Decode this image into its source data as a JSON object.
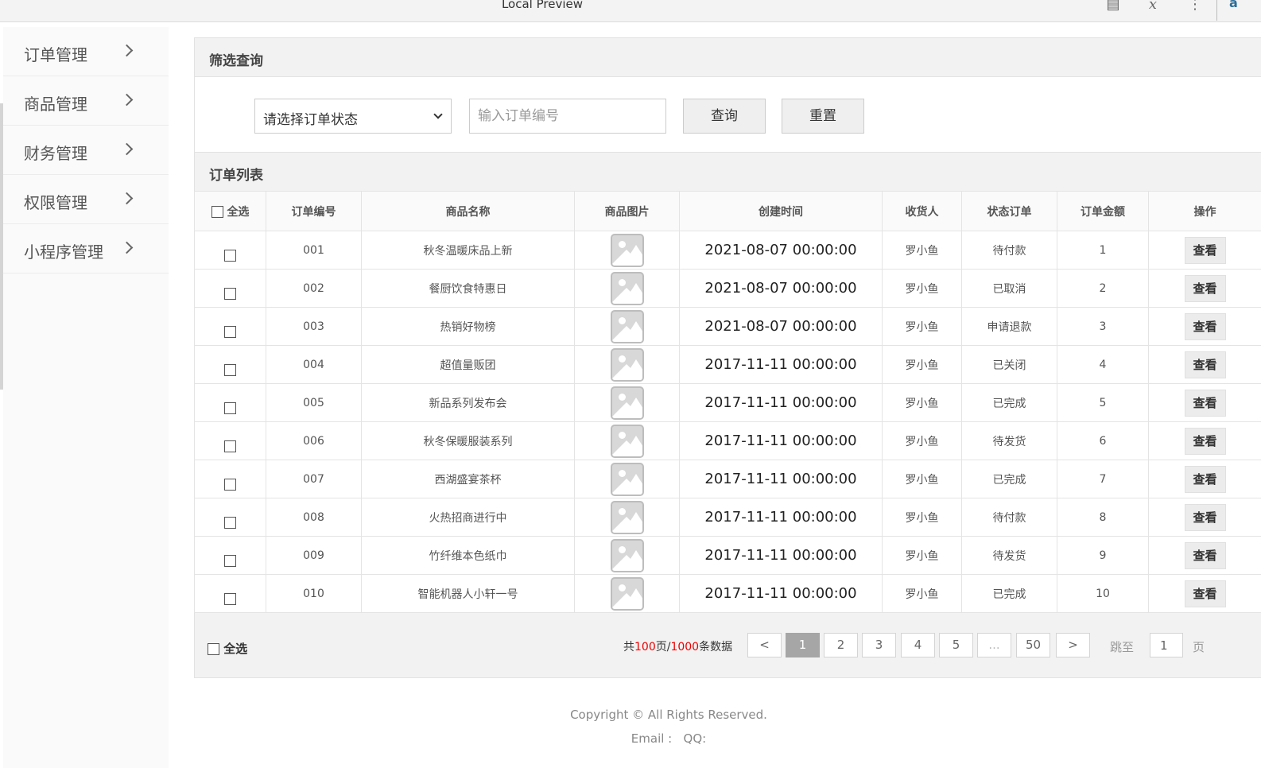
{
  "window": {
    "title": "Local Preview",
    "icons": [
      "document-icon",
      "formula-icon",
      "more-vertical-icon"
    ],
    "corner_text": "a"
  },
  "sidebar": {
    "items": [
      {
        "label": "订单管理"
      },
      {
        "label": "商品管理"
      },
      {
        "label": "财务管理"
      },
      {
        "label": "权限管理"
      },
      {
        "label": "小程序管理"
      }
    ]
  },
  "filter": {
    "title": "筛选查询",
    "status_select_value": "请选择订单状态",
    "order_no_placeholder": "输入订单编号",
    "query_label": "查询",
    "reset_label": "重置"
  },
  "order_list": {
    "title": "订单列表",
    "select_all_label": "全选",
    "columns": [
      "订单编号",
      "商品名称",
      "商品图片",
      "创建时间",
      "收货人",
      "状态订单",
      "订单金额",
      "操作"
    ],
    "view_label": "查看",
    "rows": [
      {
        "id": "001",
        "name": "秋冬温暖床品上新",
        "time": "2021-08-07 00:00:00",
        "receiver": "罗小鱼",
        "status": "待付款",
        "amount": "1"
      },
      {
        "id": "002",
        "name": "餐厨饮食特惠日",
        "time": "2021-08-07 00:00:00",
        "receiver": "罗小鱼",
        "status": "已取消",
        "amount": "2"
      },
      {
        "id": "003",
        "name": "热销好物榜",
        "time": "2021-08-07 00:00:00",
        "receiver": "罗小鱼",
        "status": "申请退款",
        "amount": "3"
      },
      {
        "id": "004",
        "name": "超值量贩团",
        "time": "2017-11-11 00:00:00",
        "receiver": "罗小鱼",
        "status": "已关闭",
        "amount": "4"
      },
      {
        "id": "005",
        "name": "新品系列发布会",
        "time": "2017-11-11 00:00:00",
        "receiver": "罗小鱼",
        "status": "已完成",
        "amount": "5"
      },
      {
        "id": "006",
        "name": "秋冬保暖服装系列",
        "time": "2017-11-11 00:00:00",
        "receiver": "罗小鱼",
        "status": "待发货",
        "amount": "6"
      },
      {
        "id": "007",
        "name": "西湖盛宴茶杯",
        "time": "2017-11-11 00:00:00",
        "receiver": "罗小鱼",
        "status": "已完成",
        "amount": "7"
      },
      {
        "id": "008",
        "name": "火热招商进行中",
        "time": "2017-11-11 00:00:00",
        "receiver": "罗小鱼",
        "status": "待付款",
        "amount": "8"
      },
      {
        "id": "009",
        "name": "竹纤维本色纸巾",
        "time": "2017-11-11 00:00:00",
        "receiver": "罗小鱼",
        "status": "待发货",
        "amount": "9"
      },
      {
        "id": "010",
        "name": "智能机器人小轩一号",
        "time": "2017-11-11 00:00:00",
        "receiver": "罗小鱼",
        "status": "已完成",
        "amount": "10"
      }
    ]
  },
  "pagination": {
    "select_all_label": "全选",
    "total_prefix": "共",
    "total_pages": "100",
    "total_mid": "页/",
    "total_items": "1000",
    "total_suffix": "条数据",
    "prev": "<",
    "pages": [
      "1",
      "2",
      "3",
      "4",
      "5",
      "...",
      "50"
    ],
    "current": "1",
    "next": ">",
    "jump_label": "跳至",
    "jump_value": "1",
    "page_unit": "页"
  },
  "footer": {
    "copyright": "Copyright © All Rights Reserved.",
    "contact": "Email :   QQ:"
  },
  "colors": {
    "highlight_red": "#ee0000",
    "current_page_bg": "#a6a6a6"
  }
}
